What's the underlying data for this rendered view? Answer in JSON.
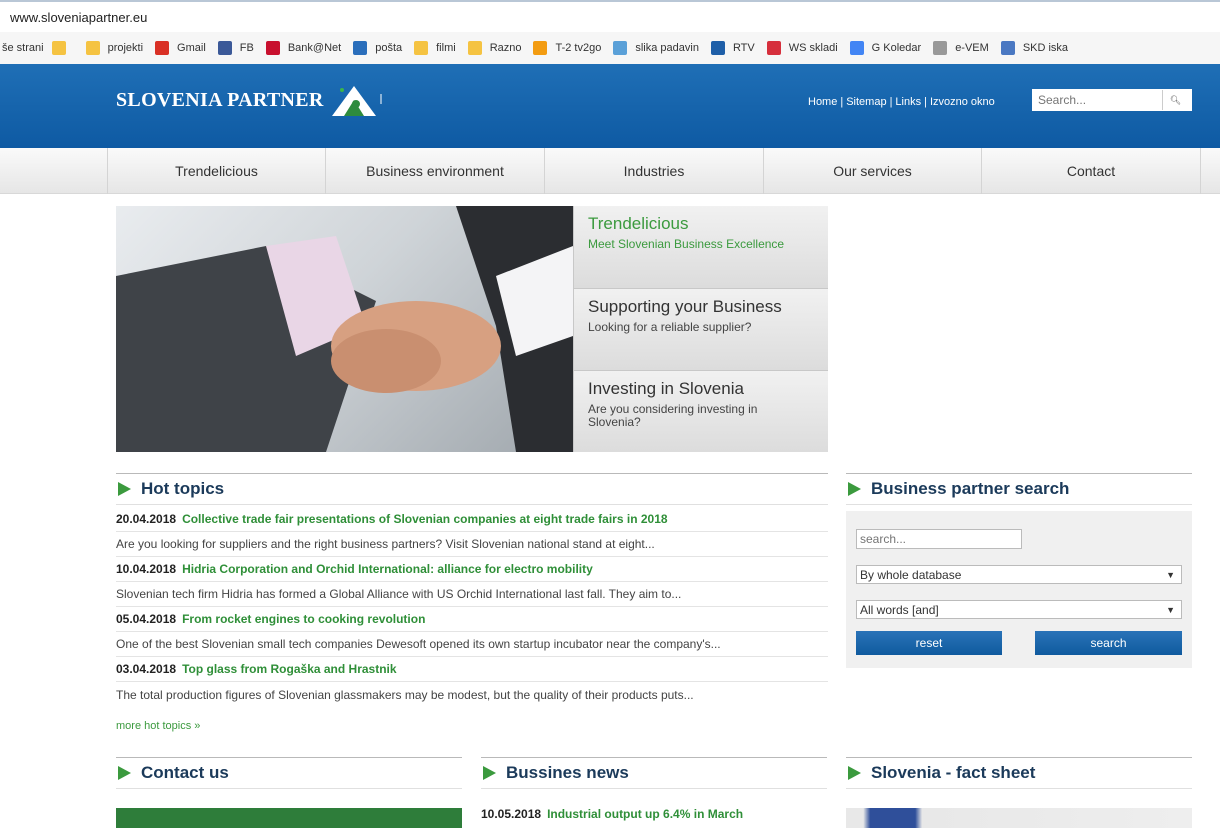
{
  "browser": {
    "url": "www.sloveniapartner.eu",
    "bookmarks": [
      {
        "label": "še strani",
        "icon": "folder-icon",
        "color": "#f5c342"
      },
      {
        "label": "projekti",
        "icon": "folder-icon",
        "color": "#f5c342"
      },
      {
        "label": "Gmail",
        "icon": "gmail-icon",
        "color": "#d93025"
      },
      {
        "label": "FB",
        "icon": "facebook-icon",
        "color": "#3b5998"
      },
      {
        "label": "Bank@Net",
        "icon": "bank-icon",
        "color": "#c8102e"
      },
      {
        "label": "pošta",
        "icon": "mail-icon",
        "color": "#2a6ebb"
      },
      {
        "label": "filmi",
        "icon": "folder-icon",
        "color": "#f5c342"
      },
      {
        "label": "Razno",
        "icon": "folder-icon",
        "color": "#f5c342"
      },
      {
        "label": "T-2 tv2go",
        "icon": "tv-icon",
        "color": "#f39c12"
      },
      {
        "label": "slika padavin",
        "icon": "weather-icon",
        "color": "#5aa0d8"
      },
      {
        "label": "RTV",
        "icon": "rtv-icon",
        "color": "#1e5fa8"
      },
      {
        "label": "WS skladi",
        "icon": "ws-icon",
        "color": "#d62f3c"
      },
      {
        "label": "G Koledar",
        "icon": "calendar-icon",
        "color": "#4285f4"
      },
      {
        "label": "e-VEM",
        "icon": "page-icon",
        "color": "#999999"
      },
      {
        "label": "SKD iska",
        "icon": "skd-icon",
        "color": "#4a78c2"
      }
    ]
  },
  "header": {
    "logo_text": "SLOVENIA PARTNER",
    "links": [
      "Home",
      "Sitemap",
      "Links",
      "Izvozno okno"
    ],
    "search_placeholder": "Search..."
  },
  "nav": {
    "items": [
      "Trendelicious",
      "Business environment",
      "Industries",
      "Our services",
      "Contact"
    ]
  },
  "hero": {
    "panels": [
      {
        "title": "Trendelicious",
        "subtitle": "Meet Slovenian Business Excellence"
      },
      {
        "title": "Supporting your Business",
        "subtitle": "Looking for a reliable supplier?"
      },
      {
        "title": "Investing in Slovenia",
        "subtitle": "Are you considering investing in Slovenia?"
      }
    ]
  },
  "hot_topics": {
    "heading": "Hot topics",
    "items": [
      {
        "date": "20.04.2018",
        "title": "Collective trade fair presentations of Slovenian companies at eight trade fairs in 2018",
        "desc": "Are you looking for suppliers and the right business partners? Visit Slovenian national stand at eight..."
      },
      {
        "date": "10.04.2018",
        "title": "Hidria Corporation and Orchid International: alliance for electro mobility",
        "desc": "Slovenian tech firm Hidria has formed a Global Alliance with US Orchid International last fall. They aim to..."
      },
      {
        "date": "05.04.2018",
        "title": "From rocket engines to cooking revolution",
        "desc": "One of the best Slovenian small tech companies Dewesoft opened its own startup incubator near the company's..."
      },
      {
        "date": "03.04.2018",
        "title": "Top glass from Rogaška and Hrastnik",
        "desc": "The total production figures of Slovenian glassmakers may be modest, but the quality of their products puts..."
      }
    ],
    "more": "more hot topics »"
  },
  "partner_search": {
    "heading": "Business partner search",
    "placeholder": "search...",
    "scope": "By whole database",
    "mode": "All words [and]",
    "reset": "reset",
    "search": "search"
  },
  "contact": {
    "heading": "Contact us"
  },
  "business_news": {
    "heading": "Bussines news",
    "first_date": "10.05.2018",
    "first_title": "Industrial output up 6.4% in March"
  },
  "fact_sheet": {
    "heading": "Slovenia - fact sheet"
  }
}
